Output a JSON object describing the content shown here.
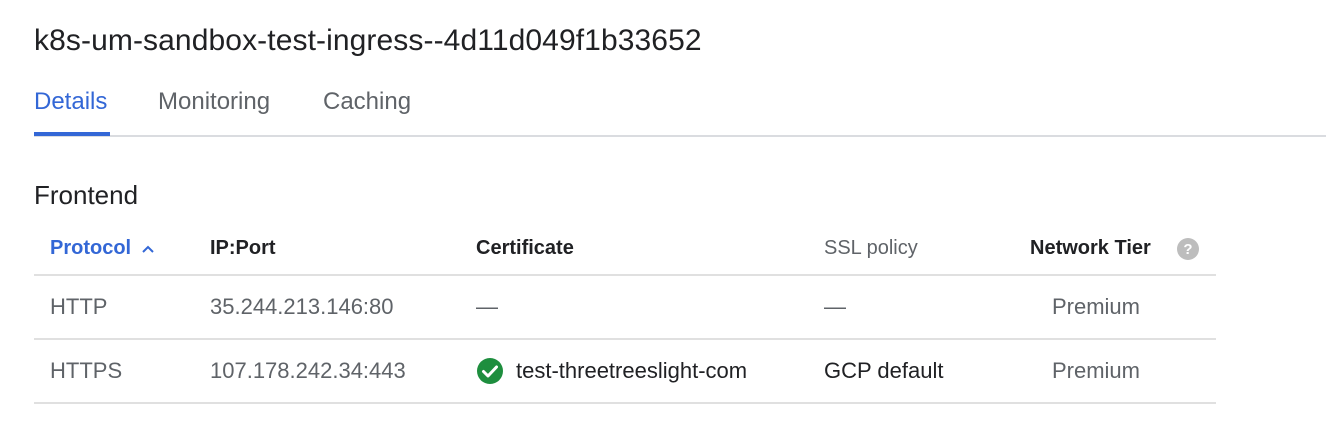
{
  "title": "k8s-um-sandbox-test-ingress--4d11d049f1b33652",
  "tabs": [
    {
      "label": "Details",
      "active": true
    },
    {
      "label": "Monitoring",
      "active": false
    },
    {
      "label": "Caching",
      "active": false
    }
  ],
  "frontend": {
    "section_title": "Frontend",
    "columns": {
      "protocol": "Protocol",
      "ip_port": "IP:Port",
      "certificate": "Certificate",
      "ssl_policy": "SSL policy",
      "network_tier": "Network Tier"
    },
    "sort": {
      "column": "protocol",
      "direction": "ascending",
      "icon": "chevron-up-icon"
    },
    "rows": [
      {
        "protocol": "HTTP",
        "ip_port": "35.244.213.146:80",
        "certificate": "—",
        "ssl_policy": "—",
        "network_tier": "Premium"
      },
      {
        "protocol": "HTTPS",
        "ip_port": "107.178.242.34:443",
        "certificate": "test-threetreeslight-com",
        "certificate_status_icon": "check-circle-icon",
        "ssl_policy": "GCP default",
        "network_tier": "Premium"
      }
    ]
  },
  "colors": {
    "accent": "#3367d6",
    "success": "#1e8e3e",
    "muted_text": "#5f6368",
    "divider": "#dadce0"
  }
}
